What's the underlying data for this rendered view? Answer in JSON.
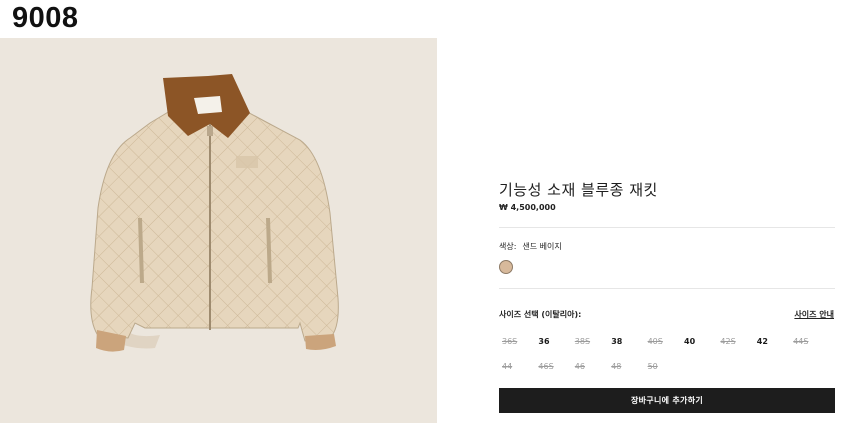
{
  "page_code": "9008",
  "product": {
    "name": "기능성 소재 블루종 재킷",
    "price": "₩ 4,500,000",
    "image_alt": "quilted beige jacket with brown corduroy collar"
  },
  "color": {
    "label": "색상:",
    "value": "샌드 베이지",
    "swatch_hex": "#d7b99b"
  },
  "sizes": {
    "label": "사이즈 선택 (이탈리아):",
    "guide_link": "사이즈 안내",
    "options": [
      {
        "label": "36S",
        "available": false
      },
      {
        "label": "36",
        "available": true
      },
      {
        "label": "38S",
        "available": false
      },
      {
        "label": "38",
        "available": true
      },
      {
        "label": "40S",
        "available": false
      },
      {
        "label": "40",
        "available": true
      },
      {
        "label": "42S",
        "available": false
      },
      {
        "label": "42",
        "available": true
      },
      {
        "label": "44S",
        "available": false
      },
      {
        "label": "44",
        "available": false
      },
      {
        "label": "46S",
        "available": false
      },
      {
        "label": "46",
        "available": false
      },
      {
        "label": "48",
        "available": false
      },
      {
        "label": "50",
        "available": false
      }
    ]
  },
  "cart_button": "장바구니에 추가하기"
}
